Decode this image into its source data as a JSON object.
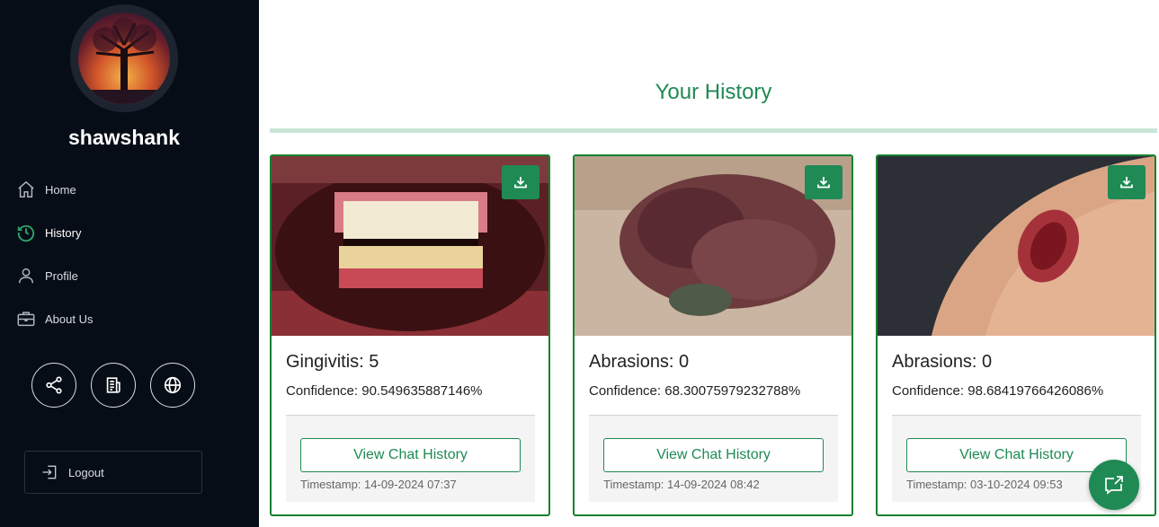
{
  "sidebar": {
    "username": "shawshank",
    "nav": [
      {
        "label": "Home",
        "icon": "home-icon"
      },
      {
        "label": "History",
        "icon": "history-icon"
      },
      {
        "label": "Profile",
        "icon": "user-icon"
      },
      {
        "label": "About Us",
        "icon": "briefcase-icon"
      }
    ],
    "actions": [
      "share-icon",
      "news-icon",
      "globe-icon"
    ],
    "logout_label": "Logout",
    "active_color": "#2ea86a"
  },
  "main": {
    "title": "Your History",
    "accent": "#1f8a54"
  },
  "cards": [
    {
      "title": "Gingivitis: 5",
      "confidence": "Confidence: 90.549635887146%",
      "button": "View Chat History",
      "timestamp": "Timestamp: 14-09-2024 07:37"
    },
    {
      "title": "Abrasions: 0",
      "confidence": "Confidence: 68.30075979232788%",
      "button": "View Chat History",
      "timestamp": "Timestamp: 14-09-2024 08:42"
    },
    {
      "title": "Abrasions: 0",
      "confidence": "Confidence: 98.68419766426086%",
      "button": "View Chat History",
      "timestamp": "Timestamp: 03-10-2024 09:53"
    }
  ]
}
